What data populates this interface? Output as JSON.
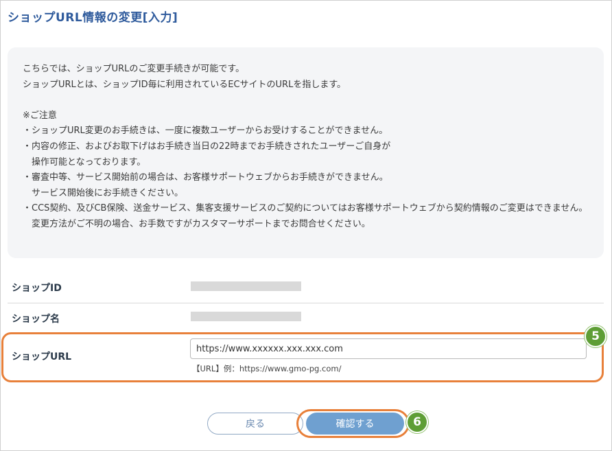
{
  "page": {
    "title": "ショップURL情報の変更[入力]"
  },
  "notice": {
    "line1": "こちらでは、ショップURLのご変更手続きが可能です。",
    "line2": "ショップURLとは、ショップID毎に利用されているECサイトのURLを指します。",
    "caution_heading": "※ご注意",
    "item1": "・ショップURL変更のお手続きは、一度に複数ユーザーからお受けすることができません。",
    "item2a": "・内容の修正、およびお取下げはお手続き当日の22時までお手続きされたユーザーご自身が",
    "item2b": "操作可能となっております。",
    "item3a": "・審査中等、サービス開始前の場合は、お客様サポートウェブからお手続きができません。",
    "item3b": "サービス開始後にお手続きください。",
    "item4a": "・CCS契約、及びCB保険、送金サービス、集客支援サービスのご契約についてはお客様サポートウェブから契約情報のご変更はできません。",
    "item4b": "変更方法がご不明の場合、お手数ですがカスタマーサポートまでお問合せください。"
  },
  "form": {
    "shop_id_label": "ショップID",
    "shop_name_label": "ショップ名",
    "shop_url_label": "ショップURL",
    "shop_url_value": "https://www.xxxxxx.xxx.xxx.com",
    "shop_url_hint": "【URL】例：https://www.gmo-pg.com/"
  },
  "buttons": {
    "back_label": "戻る",
    "confirm_label": "確認する"
  },
  "annotations": {
    "step5": "5",
    "step6": "6"
  },
  "colors": {
    "title": "#2e5a9c",
    "highlight": "#e8803a",
    "badge": "#5e9e35",
    "confirm_button": "#6fa0d0"
  }
}
